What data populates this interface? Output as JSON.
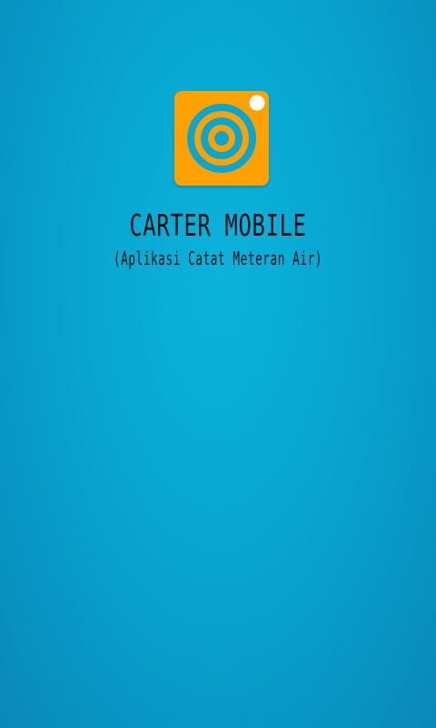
{
  "splash": {
    "title": "CARTER MOBILE",
    "subtitle": "(Aplikasi Catat Meteran Air)",
    "logo_icon": "camera-lens-icon"
  },
  "colors": {
    "background": "#08a9d3",
    "logo_orange": "#ffa200",
    "text": "#0b0e12"
  }
}
